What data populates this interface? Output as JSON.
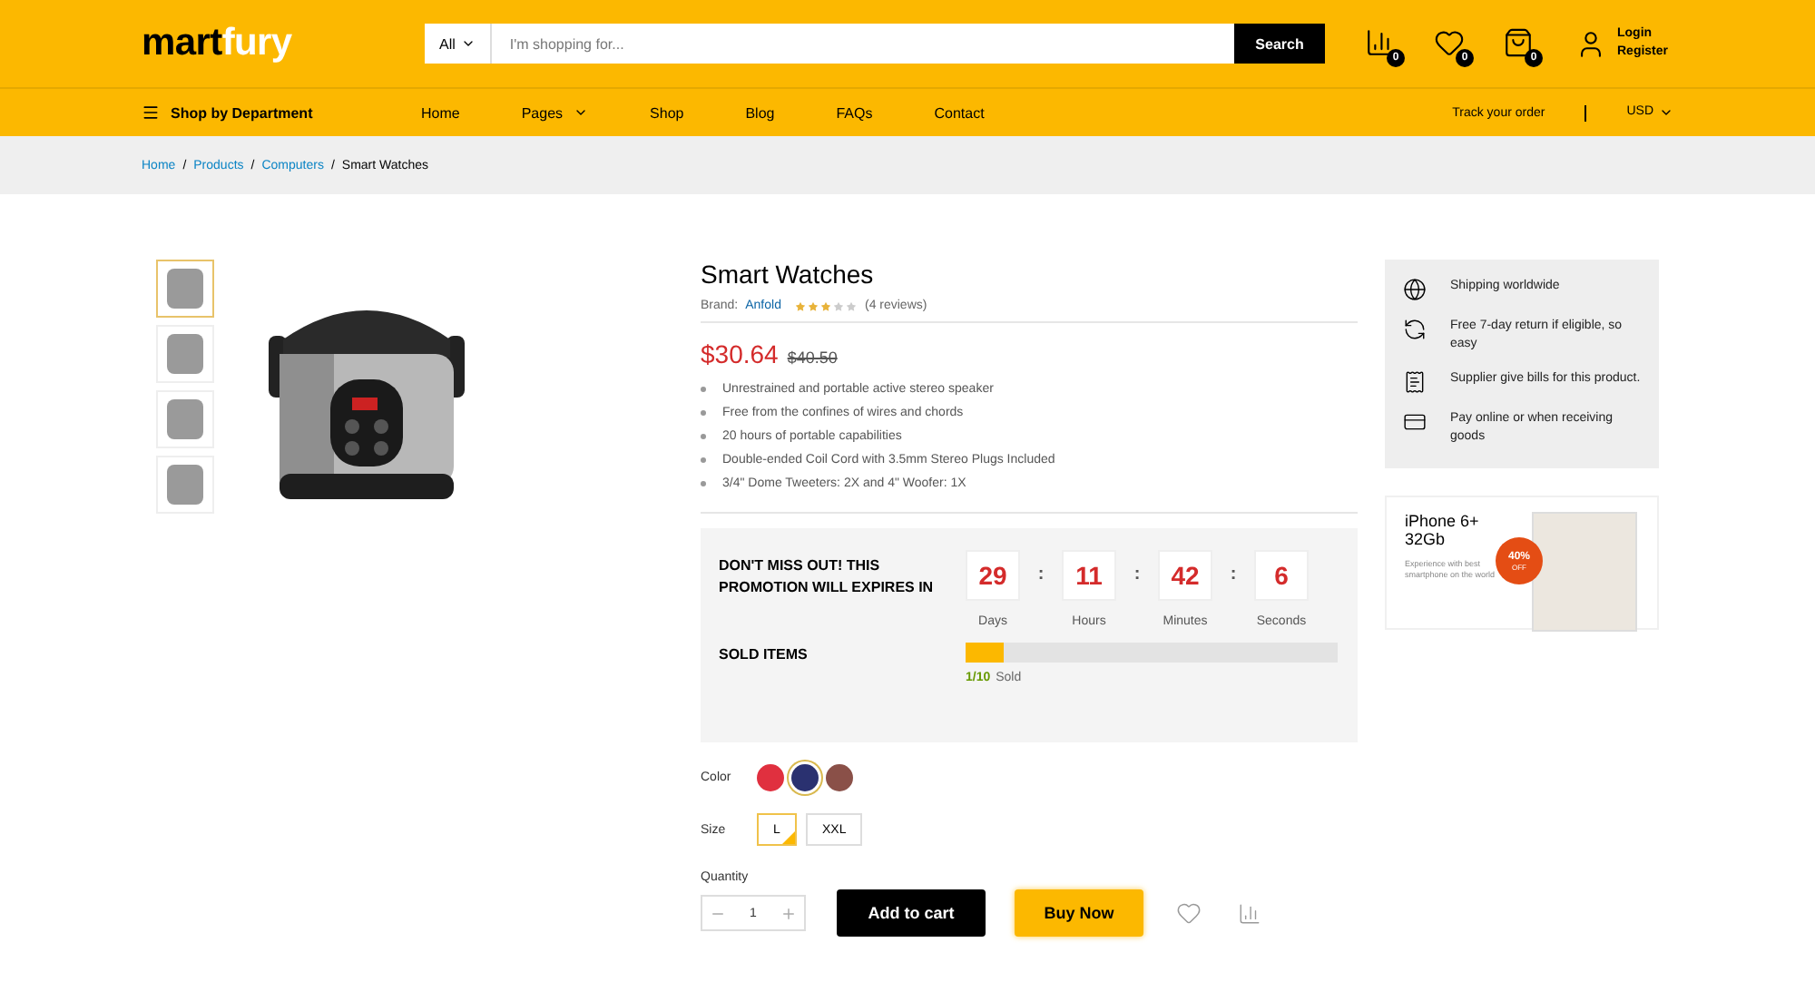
{
  "header": {
    "logo": {
      "first": "mart",
      "second": "fury"
    },
    "search": {
      "category": "All",
      "placeholder": "I'm shopping for...",
      "button": "Search"
    },
    "icons": [
      {
        "kind": "compare",
        "count": "0"
      },
      {
        "kind": "wishlist",
        "count": "0"
      },
      {
        "kind": "cart",
        "count": "0"
      }
    ],
    "account": {
      "login": "Login",
      "register": "Register"
    }
  },
  "nav": {
    "department": "Shop by Department",
    "links": [
      {
        "label": "Home",
        "dropdown": false
      },
      {
        "label": "Pages",
        "dropdown": true
      },
      {
        "label": "Shop",
        "dropdown": false
      },
      {
        "label": "Blog",
        "dropdown": false
      },
      {
        "label": "FAQs",
        "dropdown": false
      },
      {
        "label": "Contact",
        "dropdown": false
      }
    ],
    "track": "Track your order",
    "currency": "USD"
  },
  "breadcrumb_separator": "/",
  "breadcrumb": [
    {
      "label": "Home",
      "link": true
    },
    {
      "label": "Products",
      "link": true
    },
    {
      "label": "Computers",
      "link": true
    },
    {
      "label": "Smart Watches",
      "link": false
    }
  ],
  "gallery": {
    "thumbnails": [
      {
        "selected": true
      },
      {
        "selected": false
      },
      {
        "selected": false
      },
      {
        "selected": false
      }
    ]
  },
  "product": {
    "title": "Smart Watches",
    "brand_label": "Brand:",
    "brand": "Anfold",
    "stars": 3,
    "reviews": "(4 reviews)",
    "price": "$30.64",
    "old_price": "$40.50",
    "features": [
      "Unrestrained and portable active stereo speaker",
      "Free from the confines of wires and chords",
      "20 hours of portable capabilities",
      "Double-ended Coil Cord with 3.5mm Stereo Plugs Included",
      "3/4\" Dome Tweeters: 2X and 4\" Woofer: 1X"
    ]
  },
  "countdown": {
    "title": "DON'T MISS OUT! THIS PROMOTION WILL EXPIRES IN",
    "units": [
      {
        "value": "29",
        "label": "Days"
      },
      {
        "value": "11",
        "label": "Hours"
      },
      {
        "value": "42",
        "label": "Minutes"
      },
      {
        "value": "6",
        "label": "Seconds"
      }
    ],
    "separator": ":",
    "sold_label": "SOLD ITEMS",
    "level": 0.1,
    "sold_count": "1/10",
    "sold_text": "Sold"
  },
  "colors": {
    "label": "Color",
    "swatches": [
      {
        "color": "#e0303f",
        "selected": false
      },
      {
        "color": "#2a3170",
        "selected": true
      },
      {
        "color": "#8a5048",
        "selected": false
      }
    ]
  },
  "sizes": {
    "label": "Size",
    "options": [
      {
        "label": "L",
        "selected": true
      },
      {
        "label": "XXL",
        "selected": false
      }
    ]
  },
  "quantity": {
    "label": "Quantity",
    "value": "1"
  },
  "actions": {
    "add_to_cart": "Add to cart",
    "buy_now": "Buy Now"
  },
  "features_box": [
    {
      "kind": "globe",
      "text": "Shipping worldwide"
    },
    {
      "kind": "return",
      "text": "Free 7-day return if eligible, so easy"
    },
    {
      "kind": "bill",
      "text": "Supplier give bills for this product."
    },
    {
      "kind": "card",
      "text": "Pay online or when receiving goods"
    }
  ],
  "promo": {
    "title": "iPhone 6+ 32Gb",
    "subtitle": "Experience with best smartphone on the world",
    "badge": "40%",
    "badge_sub": "OFF"
  }
}
